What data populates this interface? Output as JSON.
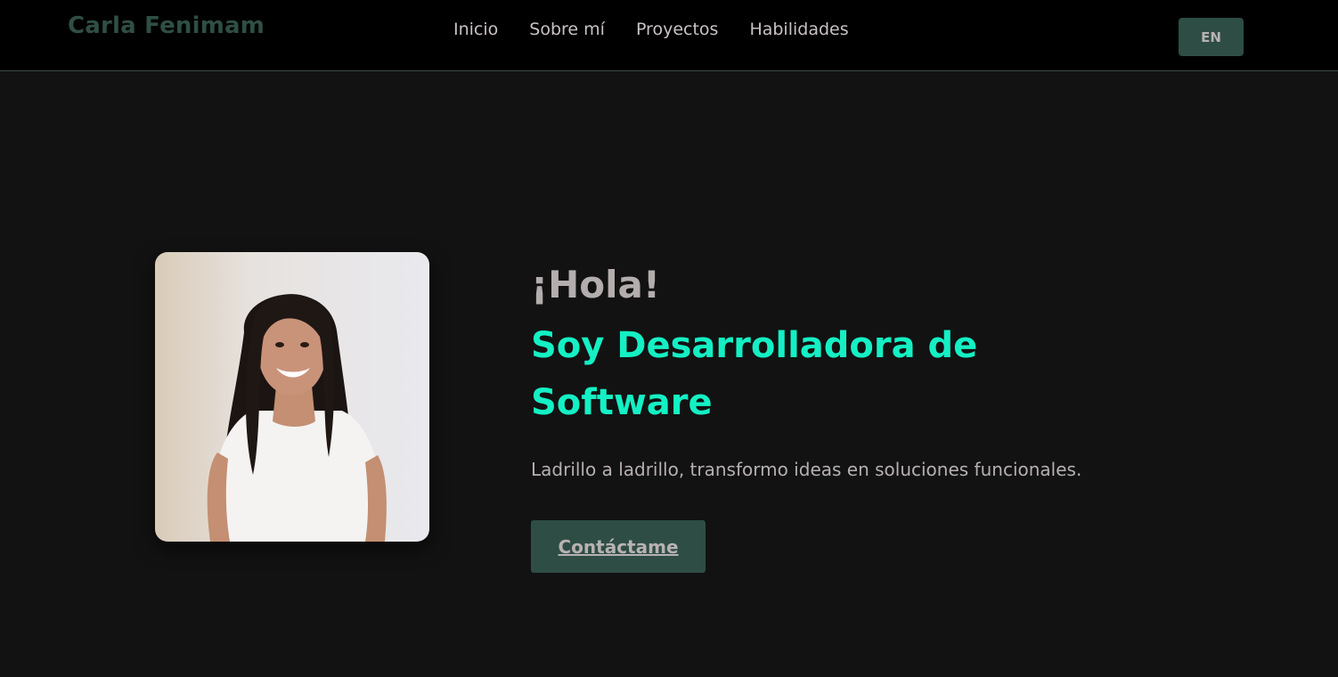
{
  "header": {
    "brand": "Carla Fenimam",
    "nav": [
      {
        "label": "Inicio"
      },
      {
        "label": "Sobre mí"
      },
      {
        "label": "Proyectos"
      },
      {
        "label": "Habilidades"
      }
    ],
    "language_button": "EN"
  },
  "hero": {
    "greeting": "¡Hola!",
    "headline": "Soy Desarrolladora de Software",
    "subtitle": "Ladrillo a ladrillo, transformo ideas en soluciones funcionales.",
    "contact_button": "Contáctame"
  },
  "colors": {
    "background": "#121212",
    "navbar": "#000000",
    "accent": "#14f0c4",
    "button": "#2e4d45",
    "brand": "#2f4f44"
  }
}
